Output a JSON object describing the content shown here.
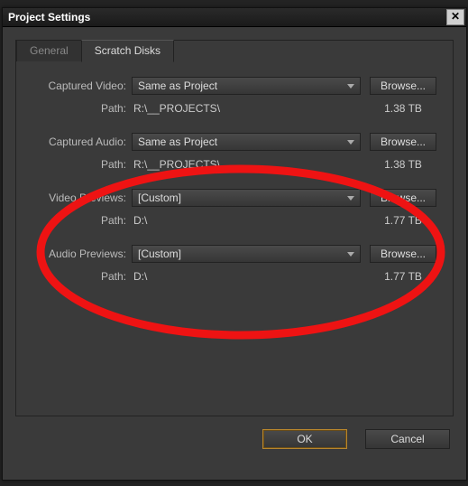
{
  "window": {
    "title": "Project Settings"
  },
  "tabs": {
    "general": "General",
    "scratch": "Scratch Disks"
  },
  "labels": {
    "captured_video": "Captured Video:",
    "captured_audio": "Captured Audio:",
    "video_previews": "Video Previews:",
    "audio_previews": "Audio Previews:",
    "path": "Path:",
    "browse": "Browse...",
    "ok": "OK",
    "cancel": "Cancel"
  },
  "rows": {
    "captured_video": {
      "dropdown": "Same as Project",
      "path": "R:\\__PROJECTS\\",
      "size": "1.38 TB"
    },
    "captured_audio": {
      "dropdown": "Same as Project",
      "path": "R:\\__PROJECTS\\",
      "size": "1.38 TB"
    },
    "video_previews": {
      "dropdown": "[Custom]",
      "path": "D:\\",
      "size": "1.77 TB"
    },
    "audio_previews": {
      "dropdown": "[Custom]",
      "path": "D:\\",
      "size": "1.77 TB"
    }
  }
}
